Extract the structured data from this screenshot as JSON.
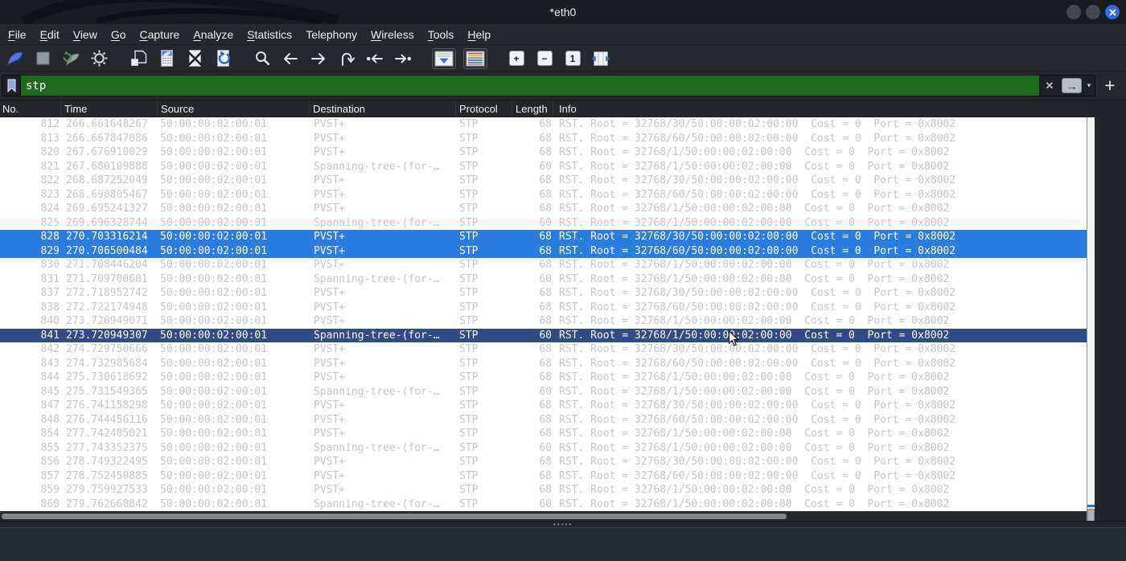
{
  "window": {
    "title": "*eth0",
    "controls": {
      "minimize": "",
      "maximize": "",
      "close_glyph": "x"
    }
  },
  "menu": {
    "items": [
      {
        "label": "File",
        "mnemonic": 0
      },
      {
        "label": "Edit",
        "mnemonic": 0
      },
      {
        "label": "View",
        "mnemonic": 0
      },
      {
        "label": "Go",
        "mnemonic": 0
      },
      {
        "label": "Capture",
        "mnemonic": 0
      },
      {
        "label": "Analyze",
        "mnemonic": 0
      },
      {
        "label": "Statistics",
        "mnemonic": 0
      },
      {
        "label": "Telephony",
        "mnemonic": -1
      },
      {
        "label": "Wireless",
        "mnemonic": 0
      },
      {
        "label": "Tools",
        "mnemonic": 0
      },
      {
        "label": "Help",
        "mnemonic": 0
      }
    ]
  },
  "toolbar": {
    "groups": [
      [
        "start-capture",
        "stop-capture",
        "restart-capture",
        "capture-options"
      ],
      [
        "open-file",
        "save-file",
        "close-file",
        "reload-file"
      ],
      [
        "find-packet",
        "go-back",
        "go-forward",
        "go-to-packet",
        "go-first",
        "go-last"
      ],
      [
        "auto-scroll",
        "colorize"
      ],
      [
        "zoom-in",
        "zoom-out",
        "zoom-reset",
        "resize-columns"
      ]
    ],
    "zoom_in_glyph": "+",
    "zoom_out_glyph": "−",
    "zoom_reset_glyph": "1"
  },
  "filter": {
    "value": "stp",
    "clear_glyph": "✕",
    "apply_glyph": "→",
    "caret_glyph": "▾",
    "add_button_label": "+"
  },
  "packet_list": {
    "columns": [
      {
        "id": "no",
        "label": "No."
      },
      {
        "id": "time",
        "label": "Time"
      },
      {
        "id": "source",
        "label": "Source"
      },
      {
        "id": "destination",
        "label": "Destination"
      },
      {
        "id": "protocol",
        "label": "Protocol"
      },
      {
        "id": "length",
        "label": "Length"
      },
      {
        "id": "info",
        "label": "Info"
      }
    ],
    "rows": [
      {
        "no": "812",
        "time": "266.661648267",
        "source": "50:00:00:02:00:01",
        "destination": "PVST+",
        "protocol": "STP",
        "length": "68",
        "info": "RST. Root = 32768/30/50:00:00:02:00:00  Cost = 0  Port = 0x8002",
        "state": ""
      },
      {
        "no": "813",
        "time": "266.667847086",
        "source": "50:00:00:02:00:01",
        "destination": "PVST+",
        "protocol": "STP",
        "length": "68",
        "info": "RST. Root = 32768/60/50:00:00:02:00:00  Cost = 0  Port = 0x8002",
        "state": ""
      },
      {
        "no": "820",
        "time": "267.676910029",
        "source": "50:00:00:02:00:01",
        "destination": "PVST+",
        "protocol": "STP",
        "length": "68",
        "info": "RST. Root = 32768/1/50:00:00:02:00:00  Cost = 0  Port = 0x8002",
        "state": ""
      },
      {
        "no": "821",
        "time": "267.680109888",
        "source": "50:00:00:02:00:01",
        "destination": "Spanning-tree-(for-…",
        "protocol": "STP",
        "length": "60",
        "info": "RST. Root = 32768/1/50:00:00:02:00:00  Cost = 0  Port = 0x8002",
        "state": ""
      },
      {
        "no": "822",
        "time": "268.687252049",
        "source": "50:00:00:02:00:01",
        "destination": "PVST+",
        "protocol": "STP",
        "length": "68",
        "info": "RST. Root = 32768/30/50:00:00:02:00:00  Cost = 0  Port = 0x8002",
        "state": ""
      },
      {
        "no": "823",
        "time": "268.690805467",
        "source": "50:00:00:02:00:01",
        "destination": "PVST+",
        "protocol": "STP",
        "length": "68",
        "info": "RST. Root = 32768/60/50:00:00:02:00:00  Cost = 0  Port = 0x8002",
        "state": ""
      },
      {
        "no": "824",
        "time": "269.695241327",
        "source": "50:00:00:02:00:01",
        "destination": "PVST+",
        "protocol": "STP",
        "length": "68",
        "info": "RST. Root = 32768/1/50:00:00:02:00:00  Cost = 0  Port = 0x8002",
        "state": ""
      },
      {
        "no": "825",
        "time": "269.696328744",
        "source": "50:00:00:02:00:01",
        "destination": "Spanning-tree-(for-…",
        "protocol": "STP",
        "length": "60",
        "info": "RST. Root = 32768/1/50:00:00:02:00:00  Cost = 0  Port = 0x8002",
        "state": ""
      },
      {
        "no": "828",
        "time": "270.703316214",
        "source": "50:00:00:02:00:01",
        "destination": "PVST+",
        "protocol": "STP",
        "length": "68",
        "info": "RST. Root = 32768/30/50:00:00:02:00:00  Cost = 0  Port = 0x8002",
        "state": "selected"
      },
      {
        "no": "829",
        "time": "270.706500484",
        "source": "50:00:00:02:00:01",
        "destination": "PVST+",
        "protocol": "STP",
        "length": "68",
        "info": "RST. Root = 32768/60/50:00:00:02:00:00  Cost = 0  Port = 0x8002",
        "state": "selected"
      },
      {
        "no": "830",
        "time": "271.708446204",
        "source": "50:00:00:02:00:01",
        "destination": "PVST+",
        "protocol": "STP",
        "length": "68",
        "info": "RST. Root = 32768/1/50:00:00:02:00:00  Cost = 0  Port = 0x8002",
        "state": ""
      },
      {
        "no": "831",
        "time": "271.709700601",
        "source": "50:00:00:02:00:01",
        "destination": "Spanning-tree-(for-…",
        "protocol": "STP",
        "length": "60",
        "info": "RST. Root = 32768/1/50:00:00:02:00:00  Cost = 0  Port = 0x8002",
        "state": ""
      },
      {
        "no": "837",
        "time": "272.718952742",
        "source": "50:00:00:02:00:01",
        "destination": "PVST+",
        "protocol": "STP",
        "length": "68",
        "info": "RST. Root = 32768/30/50:00:00:02:00:00  Cost = 0  Port = 0x8002",
        "state": ""
      },
      {
        "no": "838",
        "time": "272.722174948",
        "source": "50:00:00:02:00:01",
        "destination": "PVST+",
        "protocol": "STP",
        "length": "68",
        "info": "RST. Root = 32768/60/50:00:00:02:00:00  Cost = 0  Port = 0x8002",
        "state": ""
      },
      {
        "no": "840",
        "time": "273.720949071",
        "source": "50:00:00:02:00:01",
        "destination": "PVST+",
        "protocol": "STP",
        "length": "68",
        "info": "RST. Root = 32768/1/50:00:00:02:00:00  Cost = 0  Port = 0x8002",
        "state": ""
      },
      {
        "no": "841",
        "time": "273.720949307",
        "source": "50:00:00:02:00:01",
        "destination": "Spanning-tree-(for-…",
        "protocol": "STP",
        "length": "60",
        "info": "RST. Root = 32768/1/50:00:00:02:00:00  Cost = 0  Port = 0x8002",
        "state": "current"
      },
      {
        "no": "842",
        "time": "274.729750666",
        "source": "50:00:00:02:00:01",
        "destination": "PVST+",
        "protocol": "STP",
        "length": "68",
        "info": "RST. Root = 32768/30/50:00:00:02:00:00  Cost = 0  Port = 0x8002",
        "state": ""
      },
      {
        "no": "843",
        "time": "274.732985684",
        "source": "50:00:00:02:00:01",
        "destination": "PVST+",
        "protocol": "STP",
        "length": "68",
        "info": "RST. Root = 32768/60/50:00:00:02:00:00  Cost = 0  Port = 0x8002",
        "state": ""
      },
      {
        "no": "844",
        "time": "275.730618692",
        "source": "50:00:00:02:00:01",
        "destination": "PVST+",
        "protocol": "STP",
        "length": "68",
        "info": "RST. Root = 32768/1/50:00:00:02:00:00  Cost = 0  Port = 0x8002",
        "state": ""
      },
      {
        "no": "845",
        "time": "275.731549365",
        "source": "50:00:00:02:00:01",
        "destination": "Spanning-tree-(for-…",
        "protocol": "STP",
        "length": "60",
        "info": "RST. Root = 32768/1/50:00:00:02:00:00  Cost = 0  Port = 0x8002",
        "state": ""
      },
      {
        "no": "847",
        "time": "276.741158298",
        "source": "50:00:00:02:00:01",
        "destination": "PVST+",
        "protocol": "STP",
        "length": "68",
        "info": "RST. Root = 32768/30/50:00:00:02:00:00  Cost = 0  Port = 0x8002",
        "state": ""
      },
      {
        "no": "848",
        "time": "276.744456116",
        "source": "50:00:00:02:00:01",
        "destination": "PVST+",
        "protocol": "STP",
        "length": "68",
        "info": "RST. Root = 32768/60/50:00:00:02:00:00  Cost = 0  Port = 0x8002",
        "state": ""
      },
      {
        "no": "854",
        "time": "277.742405021",
        "source": "50:00:00:02:00:01",
        "destination": "PVST+",
        "protocol": "STP",
        "length": "68",
        "info": "RST. Root = 32768/1/50:00:00:02:00:00  Cost = 0  Port = 0x8002",
        "state": ""
      },
      {
        "no": "855",
        "time": "277.743352375",
        "source": "50:00:00:02:00:01",
        "destination": "Spanning-tree-(for-…",
        "protocol": "STP",
        "length": "60",
        "info": "RST. Root = 32768/1/50:00:00:02:00:00  Cost = 0  Port = 0x8002",
        "state": ""
      },
      {
        "no": "856",
        "time": "278.749322495",
        "source": "50:00:00:02:00:01",
        "destination": "PVST+",
        "protocol": "STP",
        "length": "68",
        "info": "RST. Root = 32768/30/50:00:00:02:00:00  Cost = 0  Port = 0x8002",
        "state": ""
      },
      {
        "no": "857",
        "time": "278.752450885",
        "source": "50:00:00:02:00:01",
        "destination": "PVST+",
        "protocol": "STP",
        "length": "68",
        "info": "RST. Root = 32768/60/50:00:00:02:00:00  Cost = 0  Port = 0x8002",
        "state": ""
      },
      {
        "no": "859",
        "time": "279.759927533",
        "source": "50:00:00:02:00:01",
        "destination": "PVST+",
        "protocol": "STP",
        "length": "68",
        "info": "RST. Root = 32768/1/50:00:00:02:00:00  Cost = 0  Port = 0x8002",
        "state": ""
      },
      {
        "no": "860",
        "time": "279.762668842",
        "source": "50:00:00:02:00:01",
        "destination": "Spanning-tree-(for-…",
        "protocol": "STP",
        "length": "60",
        "info": "RST. Root = 32768/1/50:00:00:02:00:00  Cost = 0  Port = 0x8002",
        "state": ""
      }
    ]
  },
  "splitter": {
    "dots": "•••••"
  },
  "colors": {
    "selection_blue": "#2b7ce0",
    "selection_navy": "#2c4d87",
    "filter_green": "#1e6b1e",
    "row_text_gray": "#c6c6c6",
    "accent_blue": "#2d6fd8",
    "titlebar_bg": "#191c20",
    "chrome_bg": "#25292d"
  }
}
